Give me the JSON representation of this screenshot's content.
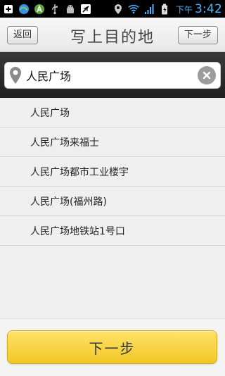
{
  "status_bar": {
    "left_icons": [
      "notification-plus-icon",
      "weather-icon",
      "a-notification-icon",
      "usb-icon",
      "android-debug-icon",
      "mute-icon"
    ],
    "right_icons": [
      "location-icon",
      "wifi-icon",
      "signal-icon",
      "battery-icon"
    ],
    "time_period": "下午",
    "time": "3:42"
  },
  "header": {
    "back_label": "返回",
    "title": "写上目的地",
    "next_label": "下一步"
  },
  "search": {
    "value": "人民广场"
  },
  "suggestions": [
    {
      "label": "人民广场"
    },
    {
      "label": "人民广场来福士"
    },
    {
      "label": "人民广场都市工业楼宇"
    },
    {
      "label": "人民广场(福州路)"
    },
    {
      "label": "人民广场地铁站1号口"
    }
  ],
  "footer": {
    "next_button_label": "下一步"
  },
  "colors": {
    "accent_yellow": "#f5cc2a",
    "time_blue": "#4fb3ff",
    "search_band": "#2a2a2a"
  }
}
